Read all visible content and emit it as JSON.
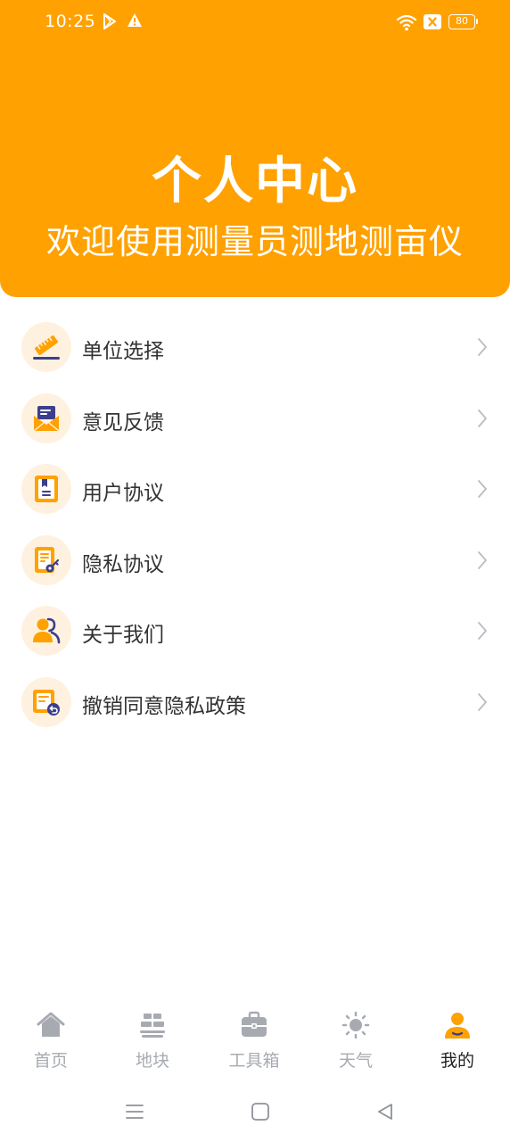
{
  "status_bar": {
    "time": "10:25",
    "battery": "80",
    "icons": [
      "play-store-icon",
      "warning-icon",
      "wifi-icon",
      "sim-x-icon",
      "battery-icon"
    ]
  },
  "header": {
    "title": "个人中心",
    "subtitle": "欢迎使用测量员测地测亩仪"
  },
  "menu": {
    "items": [
      {
        "label": "单位选择",
        "icon": "ruler-icon"
      },
      {
        "label": "意见反馈",
        "icon": "feedback-mail-icon"
      },
      {
        "label": "用户协议",
        "icon": "user-agreement-icon"
      },
      {
        "label": "隐私协议",
        "icon": "privacy-key-icon"
      },
      {
        "label": "关于我们",
        "icon": "about-us-icon"
      },
      {
        "label": "撤销同意隐私政策",
        "icon": "revoke-consent-icon"
      }
    ]
  },
  "tabbar": {
    "tabs": [
      {
        "label": "首页",
        "icon": "home-icon",
        "active": false
      },
      {
        "label": "地块",
        "icon": "plots-icon",
        "active": false
      },
      {
        "label": "工具箱",
        "icon": "toolbox-icon",
        "active": false
      },
      {
        "label": "天气",
        "icon": "weather-sun-icon",
        "active": false
      },
      {
        "label": "我的",
        "icon": "profile-icon",
        "active": true
      }
    ]
  },
  "colors": {
    "accent": "#FFA100",
    "icon_bg": "#FFF1DF",
    "icon_dark": "#3B3F8C",
    "tab_inactive": "#A7ABB1",
    "text": "#333333"
  }
}
